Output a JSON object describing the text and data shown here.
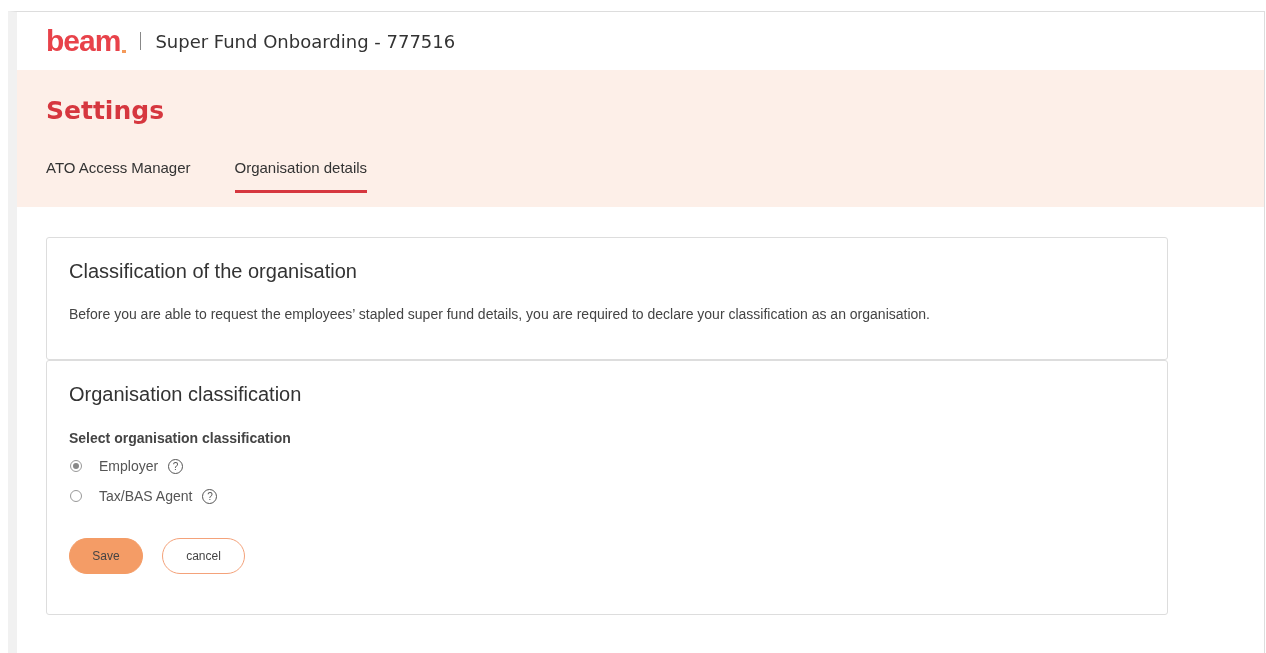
{
  "header": {
    "logo": "beam",
    "title": "Super Fund Onboarding - 777516"
  },
  "page": {
    "title": "Settings"
  },
  "tabs": [
    {
      "label": "ATO Access Manager",
      "selected": false
    },
    {
      "label": "Organisation details",
      "selected": true
    }
  ],
  "intro_card": {
    "title": "Classification of the organisation",
    "text": "Before you are able to request the employees’ stapled super fund details, you are required to declare your classification as an organisation."
  },
  "form_card": {
    "title": "Organisation classification",
    "field_label": "Select organisation classification",
    "options": [
      {
        "label": "Employer",
        "selected": true,
        "help": "?"
      },
      {
        "label": "Tax/BAS Agent",
        "selected": false,
        "help": "?"
      }
    ],
    "buttons": [
      {
        "label": "Save",
        "kind": "primary"
      },
      {
        "label": "cancel",
        "kind": "secondary"
      }
    ]
  }
}
